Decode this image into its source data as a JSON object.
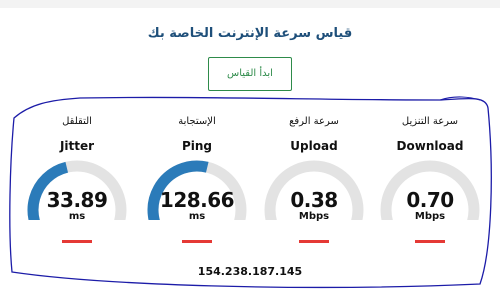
{
  "page": {
    "title": "قياس سرعة الإنترنت الخاصة بك",
    "start_button": "ابدأ القياس",
    "ip_address": "154.238.187.145"
  },
  "meters": [
    {
      "ar": "التقلقل",
      "en": "Jitter",
      "value": "33.89",
      "unit": "ms",
      "fill": 0.45,
      "color": "#2b7bb9"
    },
    {
      "ar": "الإستجابة",
      "en": "Ping",
      "value": "128.66",
      "unit": "ms",
      "fill": 0.55,
      "color": "#2b7bb9"
    },
    {
      "ar": "سرعة الرفع",
      "en": "Upload",
      "value": "0.38",
      "unit": "Mbps",
      "fill": 0.09,
      "color": "#27ae60"
    },
    {
      "ar": "سرعة التنزيل",
      "en": "Download",
      "value": "0.70",
      "unit": "Mbps",
      "fill": 0.11,
      "color": "#27ae60"
    }
  ],
  "colors": {
    "track": "#e3e3e3",
    "accent_green": "#2e8b4a",
    "title_blue": "#1e4f7a",
    "underline_red": "#e53935",
    "scribble_blue": "#1c1ca8"
  }
}
